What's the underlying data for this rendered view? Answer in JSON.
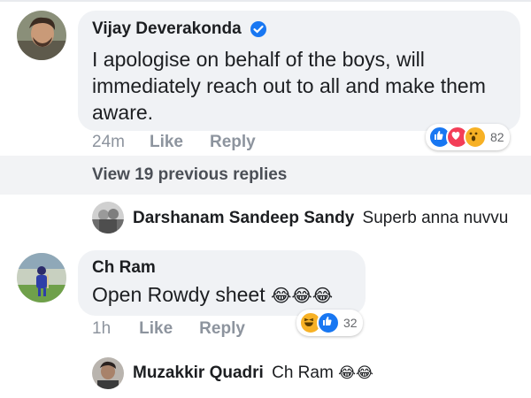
{
  "comment1": {
    "author": "Vijay Deverakonda",
    "text": "I apologise on behalf of the boys, will immediately reach out to all and make them aware.",
    "time": "24m",
    "like": "Like",
    "reply": "Reply",
    "reaction_count": "82",
    "reactions": [
      "like-icon",
      "love-icon",
      "wow-icon"
    ]
  },
  "view_previous": "View 19 previous replies",
  "reply1": {
    "author": "Darshanam Sandeep Sandy",
    "text": "Superb anna nuvvu"
  },
  "comment2": {
    "author": "Ch Ram",
    "text": "Open Rowdy sheet",
    "emoji": "😂😂😂",
    "time": "1h",
    "like": "Like",
    "reply": "Reply",
    "reaction_count": "32",
    "reactions": [
      "haha-icon",
      "like-icon"
    ]
  },
  "reply2": {
    "author": "Muzakkir Quadri",
    "text": "Ch Ram",
    "emoji": "😂😂"
  },
  "colors": {
    "like_blue": "#1877f2",
    "love_red": "#f33e58",
    "haha_yellow": "#f7b125",
    "bubble": "#f0f2f5",
    "muted": "#8d949e"
  }
}
